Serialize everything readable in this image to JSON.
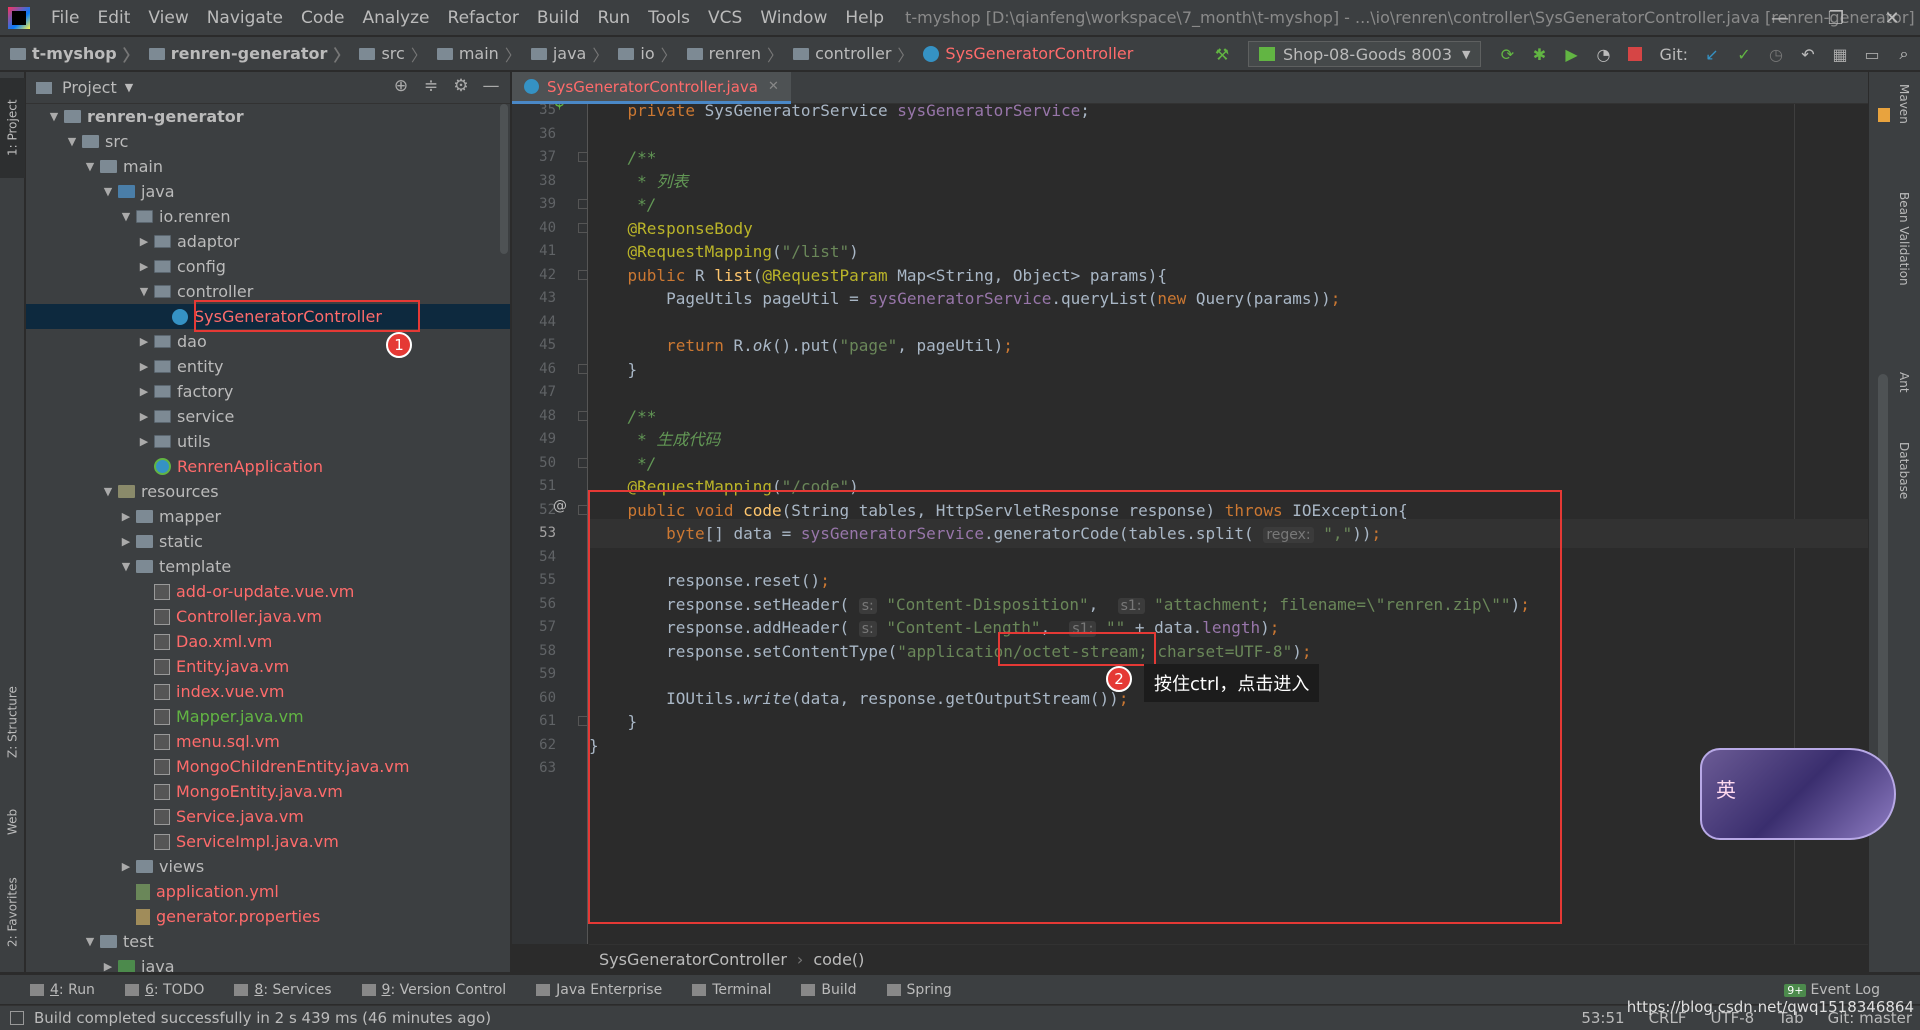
{
  "menubar": {
    "items": [
      "File",
      "Edit",
      "View",
      "Navigate",
      "Code",
      "Analyze",
      "Refactor",
      "Build",
      "Run",
      "Tools",
      "VCS",
      "Window",
      "Help"
    ],
    "title": "t-myshop [D:\\qianfeng\\workspace\\7_month\\t-myshop] - ...\\io\\renren\\controller\\SysGeneratorController.java [renren-generator]",
    "minimize": "—",
    "restore": "❐",
    "close": "✕"
  },
  "navbar": {
    "crumbs": [
      "t-myshop",
      "renren-generator",
      "src",
      "main",
      "java",
      "io",
      "renren",
      "controller",
      "SysGeneratorController"
    ],
    "run_config": "Shop-08-Goods 8003",
    "git_label": "Git:"
  },
  "left_strip": {
    "project_tab": "1: Project",
    "structure_tab": "Z: Structure",
    "web_tab": "Web",
    "favorites_tab": "2: Favorites"
  },
  "project_panel": {
    "title": "Project",
    "tree": [
      {
        "label": "renren-generator",
        "depth": 1,
        "arrow": "open",
        "icon": "module"
      },
      {
        "label": "src",
        "depth": 2,
        "arrow": "open",
        "icon": "folder"
      },
      {
        "label": "main",
        "depth": 3,
        "arrow": "open",
        "icon": "folder"
      },
      {
        "label": "java",
        "depth": 4,
        "arrow": "open",
        "icon": "src"
      },
      {
        "label": "io.renren",
        "depth": 5,
        "arrow": "open",
        "icon": "pkg"
      },
      {
        "label": "adaptor",
        "depth": 6,
        "arrow": "closed",
        "icon": "pkg"
      },
      {
        "label": "config",
        "depth": 6,
        "arrow": "closed",
        "icon": "pkg"
      },
      {
        "label": "controller",
        "depth": 6,
        "arrow": "open",
        "icon": "pkg"
      },
      {
        "label": "SysGeneratorController",
        "depth": 7,
        "arrow": "none",
        "icon": "class",
        "color": "red",
        "selected": true
      },
      {
        "label": "dao",
        "depth": 6,
        "arrow": "closed",
        "icon": "pkg"
      },
      {
        "label": "entity",
        "depth": 6,
        "arrow": "closed",
        "icon": "pkg"
      },
      {
        "label": "factory",
        "depth": 6,
        "arrow": "closed",
        "icon": "pkg"
      },
      {
        "label": "service",
        "depth": 6,
        "arrow": "closed",
        "icon": "pkg"
      },
      {
        "label": "utils",
        "depth": 6,
        "arrow": "closed",
        "icon": "pkg"
      },
      {
        "label": "RenrenApplication",
        "depth": 6,
        "arrow": "none",
        "icon": "app",
        "color": "red"
      },
      {
        "label": "resources",
        "depth": 4,
        "arrow": "open",
        "icon": "res"
      },
      {
        "label": "mapper",
        "depth": 5,
        "arrow": "closed",
        "icon": "folder"
      },
      {
        "label": "static",
        "depth": 5,
        "arrow": "closed",
        "icon": "folder"
      },
      {
        "label": "template",
        "depth": 5,
        "arrow": "open",
        "icon": "folder"
      },
      {
        "label": "add-or-update.vue.vm",
        "depth": 6,
        "arrow": "none",
        "icon": "vm",
        "color": "red"
      },
      {
        "label": "Controller.java.vm",
        "depth": 6,
        "arrow": "none",
        "icon": "vm",
        "color": "red"
      },
      {
        "label": "Dao.xml.vm",
        "depth": 6,
        "arrow": "none",
        "icon": "vm",
        "color": "red"
      },
      {
        "label": "Entity.java.vm",
        "depth": 6,
        "arrow": "none",
        "icon": "vm",
        "color": "red"
      },
      {
        "label": "index.vue.vm",
        "depth": 6,
        "arrow": "none",
        "icon": "vm",
        "color": "red"
      },
      {
        "label": "Mapper.java.vm",
        "depth": 6,
        "arrow": "none",
        "icon": "vm",
        "color": "green"
      },
      {
        "label": "menu.sql.vm",
        "depth": 6,
        "arrow": "none",
        "icon": "vm",
        "color": "red"
      },
      {
        "label": "MongoChildrenEntity.java.vm",
        "depth": 6,
        "arrow": "none",
        "icon": "vm",
        "color": "red"
      },
      {
        "label": "MongoEntity.java.vm",
        "depth": 6,
        "arrow": "none",
        "icon": "vm",
        "color": "red"
      },
      {
        "label": "Service.java.vm",
        "depth": 6,
        "arrow": "none",
        "icon": "vm",
        "color": "red"
      },
      {
        "label": "ServiceImpl.java.vm",
        "depth": 6,
        "arrow": "none",
        "icon": "vm",
        "color": "red"
      },
      {
        "label": "views",
        "depth": 5,
        "arrow": "closed",
        "icon": "folder"
      },
      {
        "label": "application.yml",
        "depth": 5,
        "arrow": "none",
        "icon": "yml",
        "color": "red"
      },
      {
        "label": "generator.properties",
        "depth": 5,
        "arrow": "none",
        "icon": "prop",
        "color": "red"
      },
      {
        "label": "test",
        "depth": 3,
        "arrow": "open",
        "icon": "folder"
      },
      {
        "label": "java",
        "depth": 4,
        "arrow": "closed",
        "icon": "test"
      }
    ]
  },
  "editor": {
    "tab_label": "SysGeneratorController.java",
    "current_line": 53,
    "breadcrumb": [
      "SysGeneratorController",
      "code()"
    ]
  },
  "code_lines": [
    {
      "n": 35,
      "html": "    <span class=\"kw\">private</span> SysGeneratorService <span class=\"fld\">sysGeneratorService</span>;"
    },
    {
      "n": 36,
      "html": ""
    },
    {
      "n": 37,
      "html": "    <span class=\"cm\">/**</span>"
    },
    {
      "n": 38,
      "html": "<span class=\"cm\">     * 列表</span>"
    },
    {
      "n": 39,
      "html": "<span class=\"cm\">     */</span>"
    },
    {
      "n": 40,
      "html": "    <span class=\"ann\">@ResponseBody</span>"
    },
    {
      "n": 41,
      "html": "    <span class=\"ann\">@RequestMapping</span>(<span class=\"str\">\"/list\"</span>)"
    },
    {
      "n": 42,
      "html": "    <span class=\"kw\">public</span> R <span class=\"fn\">list</span>(<span class=\"ann\">@RequestParam</span> Map&lt;String, Object&gt; params){"
    },
    {
      "n": 43,
      "html": "        PageUtils pageUtil = <span class=\"fld\">sysGeneratorService</span>.queryList(<span class=\"kw\">new</span> Query(params))<span class=\"kw\">;</span>"
    },
    {
      "n": 44,
      "html": ""
    },
    {
      "n": 45,
      "html": "        <span class=\"kw\">return</span> R.<span class=\"it\">ok</span>().put(<span class=\"str\">\"page\"</span>, pageUtil)<span class=\"kw\">;</span>"
    },
    {
      "n": 46,
      "html": "    }"
    },
    {
      "n": 47,
      "html": ""
    },
    {
      "n": 48,
      "html": "    <span class=\"cm\">/**</span>"
    },
    {
      "n": 49,
      "html": "<span class=\"cm\">     * 生成代码</span>"
    },
    {
      "n": 50,
      "html": "<span class=\"cm\">     */</span>"
    },
    {
      "n": 51,
      "html": "    <span class=\"ann\">@RequestMapping</span>(<span class=\"str\">\"/code\"</span>)"
    },
    {
      "n": 52,
      "html": "    <span class=\"kw\">public void</span> <span class=\"fn\">code</span>(String tables, HttpServletResponse response) <span class=\"kw\">throws</span> IOException{"
    },
    {
      "n": 53,
      "html": "        <span class=\"kw\">byte</span>[] data = <span class=\"fld\">sysGeneratorService</span>.generatorCode(tables.split( <span class=\"hint\">regex:</span> <span class=\"str\">\",\"</span>))<span class=\"kw\">;</span>"
    },
    {
      "n": 54,
      "html": ""
    },
    {
      "n": 55,
      "html": "        response.reset()<span class=\"kw\">;</span>"
    },
    {
      "n": 56,
      "html": "        response.setHeader( <span class=\"hint\">s:</span> <span class=\"str\">\"Content-Disposition\"</span>,  <span class=\"hint\">s1:</span> <span class=\"str\">\"attachment; filename=\\\"renren.zip\\\"\"</span>)<span class=\"kw\">;</span>"
    },
    {
      "n": 57,
      "html": "        response.addHeader( <span class=\"hint\">s:</span> <span class=\"str\">\"Content-Length\"</span>,  <span class=\"hint\">s1:</span> <span class=\"str\">\"\"</span> + data.<span class=\"fld\">length</span>)<span class=\"kw\">;</span>"
    },
    {
      "n": 58,
      "html": "        response.setContentType(<span class=\"str\">\"application/octet-stream; charset=UTF-8\"</span>)<span class=\"kw\">;</span>"
    },
    {
      "n": 59,
      "html": ""
    },
    {
      "n": 60,
      "html": "        IOUtils.<span class=\"it\">write</span>(data, response.getOutputStream())<span class=\"kw\">;</span>"
    },
    {
      "n": 61,
      "html": "    }"
    },
    {
      "n": 62,
      "html": "}"
    },
    {
      "n": 63,
      "html": ""
    }
  ],
  "annotations": {
    "badge1": "1",
    "badge2": "2",
    "tooltip": "按住ctrl，点击进入",
    "avatar_char": "英"
  },
  "right_strip": {
    "maven": "Maven",
    "bean_validation": "Bean Validation",
    "ant": "Ant",
    "database": "Database"
  },
  "bottom_tools": [
    {
      "key": "4",
      "label": ": Run"
    },
    {
      "key": "6",
      "label": ": TODO"
    },
    {
      "key": "8",
      "label": ": Services"
    },
    {
      "key": "9",
      "label": ": Version Control"
    },
    {
      "key": "",
      "label": "Java Enterprise"
    },
    {
      "key": "",
      "label": "Terminal"
    },
    {
      "key": "",
      "label": "Build"
    },
    {
      "key": "",
      "label": "Spring"
    }
  ],
  "event_log": "Event Log",
  "status": {
    "message": "Build completed successfully in 2 s 439 ms (46 minutes ago)",
    "position": "53:51",
    "line_sep": "CRLF",
    "encoding": "UTF-8",
    "indent": "Tab",
    "git": "Git: master",
    "watermark": "https://blog.csdn.net/qwq1518346864"
  },
  "colors": {
    "annotation_red": "#e53935",
    "editor_bg": "#2b2b2b",
    "panel_bg": "#3c3f41",
    "selection": "#0d293e"
  }
}
